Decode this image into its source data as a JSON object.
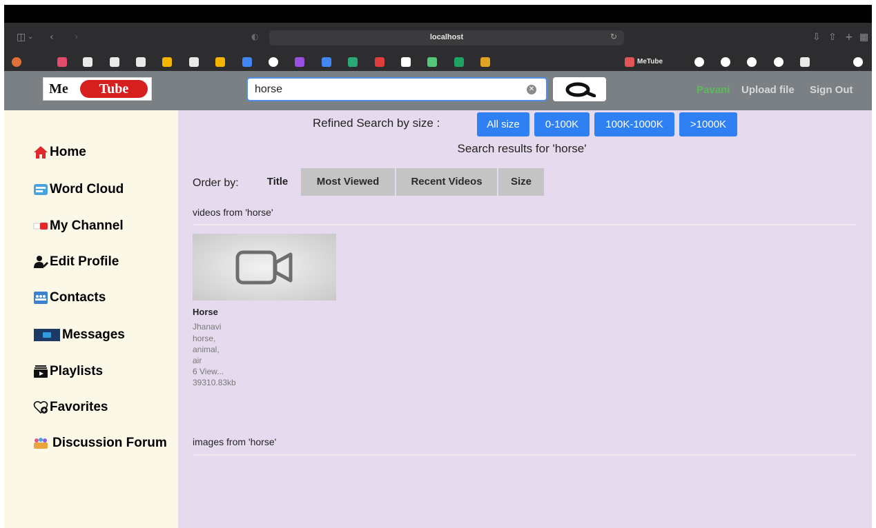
{
  "browser": {
    "url": "localhost",
    "active_tab_label": "MeTube"
  },
  "header": {
    "logo_part1": "Me",
    "logo_part2": "Tube",
    "search_value": "horse",
    "user_name": "Pavani",
    "upload_label": "Upload file",
    "signout_label": "Sign Out"
  },
  "sidebar": {
    "items": [
      {
        "label": "Home",
        "icon": "home-icon"
      },
      {
        "label": "Word Cloud",
        "icon": "word-cloud-icon"
      },
      {
        "label": "My Channel",
        "icon": "youtube-icon"
      },
      {
        "label": "Edit Profile",
        "icon": "user-edit-icon"
      },
      {
        "label": "Contacts",
        "icon": "contacts-icon"
      },
      {
        "label": "Messages",
        "icon": "messages-icon"
      },
      {
        "label": "Playlists",
        "icon": "playlist-icon"
      },
      {
        "label": "Favorites",
        "icon": "heart-add-icon"
      },
      {
        "label": "Discussion Forum",
        "icon": "forum-icon"
      }
    ]
  },
  "main": {
    "refine_label": "Refined Search by size :",
    "size_buttons": [
      "All size",
      "0-100K",
      "100K-1000K",
      ">1000K"
    ],
    "results_title": "Search results for 'horse'",
    "order_label": "Order by:",
    "order_tabs": [
      "Title",
      "Most Viewed",
      "Recent Videos",
      "Size"
    ],
    "videos_heading": "videos from 'horse'",
    "images_heading": "images from 'horse'",
    "video": {
      "title": "Horse",
      "author": "Jhanavi",
      "tags": [
        "horse,",
        "animal,",
        "air"
      ],
      "views": "6 View...",
      "size": "39310.83kb"
    }
  },
  "colors": {
    "header_bg": "#7b8085",
    "sidebar_bg": "#fcf8e7",
    "main_bg": "#e6dbee",
    "accent_blue": "#2f80f2",
    "user_green": "#5cba5c",
    "logo_red": "#d62020"
  }
}
